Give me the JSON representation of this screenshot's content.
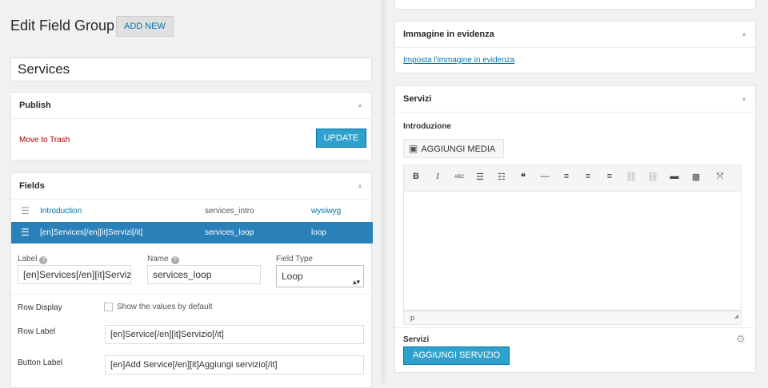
{
  "left": {
    "page_title": "Edit Field Group",
    "add_new_label": "ADD NEW",
    "title_value": "Services",
    "publish": {
      "heading": "Publish",
      "trash_link": "Move to Trash",
      "update_label": "UPDATE"
    },
    "fields": {
      "heading": "Fields",
      "rows": [
        {
          "label": "Introduction",
          "name": "services_intro",
          "type": "wysiwyg"
        },
        {
          "label": "[en]Services[/en][it]Servizi[/it]",
          "name": "services_loop",
          "type": "loop"
        }
      ],
      "edit": {
        "label_caption": "Label",
        "label_value": "[en]Services[/en][it]Servizi[/it]",
        "name_caption": "Name",
        "name_value": "services_loop",
        "type_caption": "Field Type",
        "type_value": "Loop"
      },
      "row_display_label": "Row Display",
      "row_display_option": "Show the values by default",
      "row_label_caption": "Row Label",
      "row_label_value": "[en]Service[/en][it]Servizio[/it]",
      "button_label_caption": "Button Label",
      "button_label_value": "[en]Add Service[/en][it]Aggiungi servizio[/it]"
    }
  },
  "right": {
    "featured": {
      "heading": "Immagine in evidenza",
      "link": "Imposta l'immagine in evidenza"
    },
    "servizi": {
      "heading": "Servizi",
      "intro_label": "Introduzione",
      "media_button": "AGGIUNGI MEDIA",
      "toolbar": [
        "B",
        "I",
        "ABC",
        "☰",
        "☷",
        "❝",
        "—",
        "≡",
        "≡",
        "≡",
        "⛓",
        "⛓",
        "▬",
        "▦",
        "⤧"
      ],
      "status_path": "p",
      "loop_label": "Servizi",
      "add_button": "AGGIUNGI SERVIZIO"
    }
  },
  "colors": {
    "accent": "#2ea2cc",
    "active_row": "#2a80b9",
    "link": "#0073aa",
    "trash": "#aa0000"
  }
}
